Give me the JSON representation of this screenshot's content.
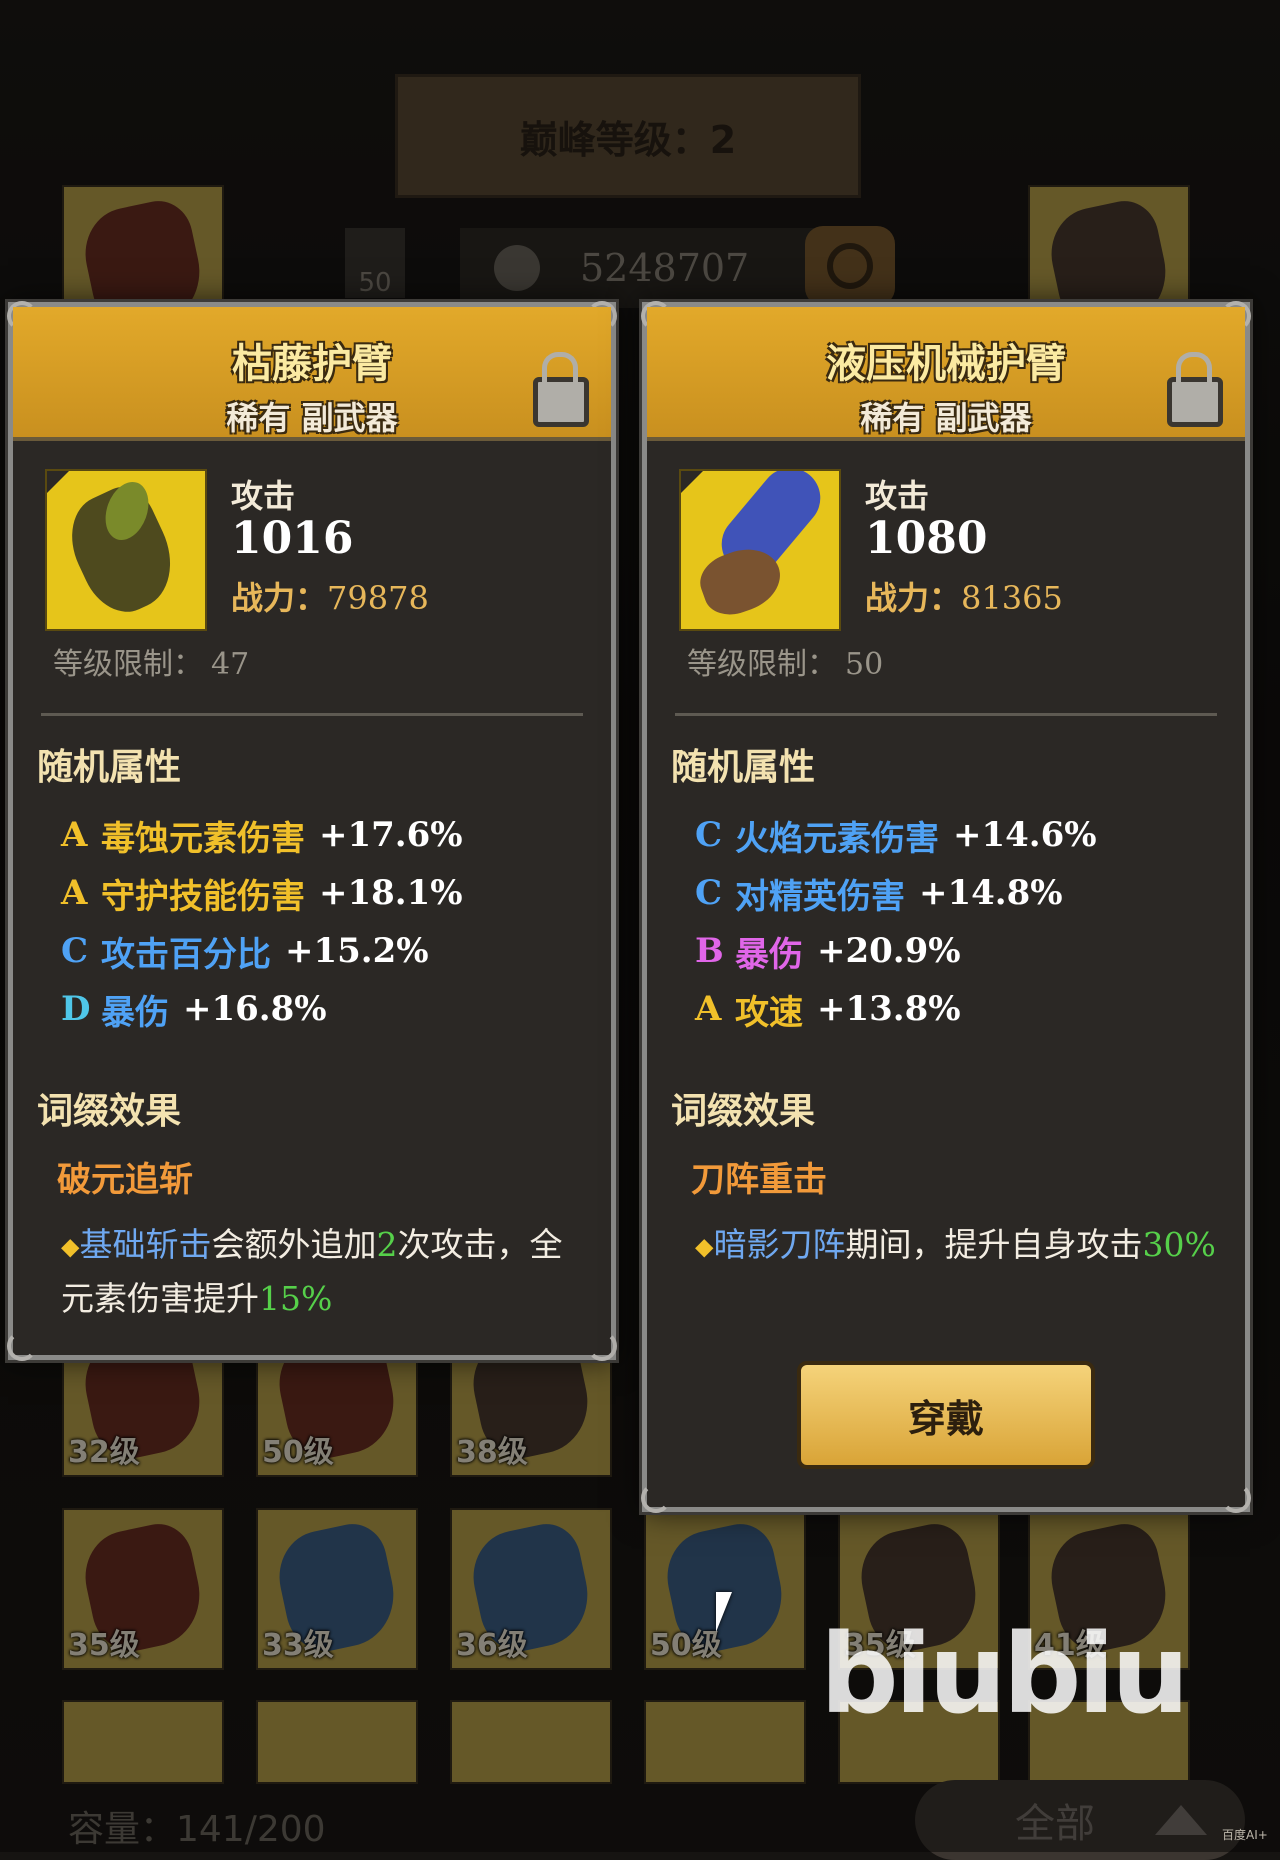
{
  "background": {
    "banner_text": "巅峰等级：2",
    "level_box_text": "50",
    "power_total": "5248707",
    "capacity": "容量：141/200",
    "filter_label": "全部",
    "row1_levels": [
      "32级",
      "50级",
      "38级"
    ],
    "row2_levels": [
      "35级",
      "33级",
      "36级",
      "50级",
      "35级",
      "41级"
    ]
  },
  "cards": [
    {
      "name": "枯藤护臂",
      "rarity_type": "稀有 副武器",
      "stat_label": "攻击",
      "stat_value": "1016",
      "power_label": "战力：",
      "power_value": "79878",
      "level_req_label": "等级限制：",
      "level_req_value": "47",
      "random_attr_title": "随机属性",
      "attributes": [
        {
          "grade": "A",
          "name": "毒蚀元素伤害",
          "value": "+17.6%"
        },
        {
          "grade": "A",
          "name": "守护技能伤害",
          "value": "+18.1%"
        },
        {
          "grade": "C",
          "name": "攻击百分比",
          "value": "+15.2%"
        },
        {
          "grade": "D",
          "name": "暴伤",
          "value": "+16.8%"
        }
      ],
      "affix_title": "词缀效果",
      "affix_name": "破元追斩",
      "affix_desc": {
        "skill": "基础斩击",
        "t1": "会额外追加",
        "n1": "2",
        "t2": "次攻击，全元素伤害提升",
        "n2": "15%"
      }
    },
    {
      "name": "液压机械护臂",
      "rarity_type": "稀有 副武器",
      "stat_label": "攻击",
      "stat_value": "1080",
      "power_label": "战力：",
      "power_value": "81365",
      "level_req_label": "等级限制：",
      "level_req_value": "50",
      "random_attr_title": "随机属性",
      "attributes": [
        {
          "grade": "C",
          "name": "火焰元素伤害",
          "value": "+14.6%"
        },
        {
          "grade": "C",
          "name": "对精英伤害",
          "value": "+14.8%"
        },
        {
          "grade": "B",
          "name": "暴伤",
          "value": "+20.9%"
        },
        {
          "grade": "A",
          "name": "攻速",
          "value": "+13.8%"
        }
      ],
      "affix_title": "词缀效果",
      "affix_name": "刀阵重击",
      "affix_desc": {
        "skill": "暗影刀阵",
        "t1": "期间，提升自身攻击",
        "n1": "30%"
      },
      "equip_button": "穿戴"
    }
  ],
  "watermark": "biubiu",
  "corner_note": "百度AI+",
  "colors": {
    "grade_A": "#f1c02a",
    "grade_B": "#e066e8",
    "grade_C": "#4fa2f5",
    "grade_D": "#4fc6e8",
    "header": "#e2a92a"
  }
}
